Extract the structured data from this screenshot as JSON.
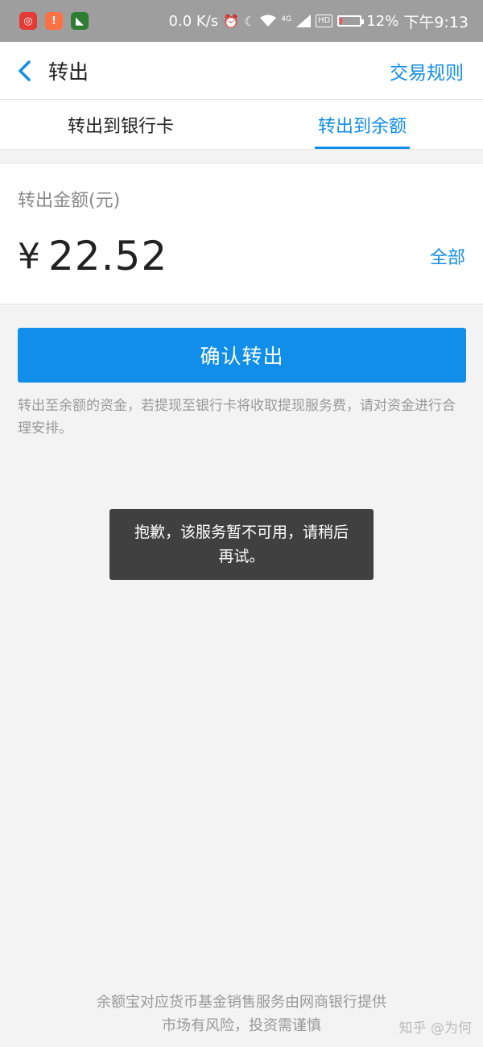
{
  "status_bar": {
    "net_speed": "0.0 K/s",
    "network": "4G",
    "hd": "HD",
    "battery_pct": "12%",
    "battery_level": 0.12,
    "time": "下午9:13",
    "colors": {
      "app1": "#e53935",
      "app2": "#ff7043",
      "app3": "#2e7d32"
    }
  },
  "header": {
    "back_icon": "chevron-left-icon",
    "title": "转出",
    "rules_link": "交易规则"
  },
  "tabs": [
    {
      "label": "转出到银行卡",
      "active": false
    },
    {
      "label": "转出到余额",
      "active": true
    }
  ],
  "amount": {
    "label": "转出金额(元)",
    "currency": "¥",
    "value": "22.52",
    "all_label": "全部"
  },
  "confirm_button": "确认转出",
  "notice": "转出至余额的资金，若提现至银行卡将收取提现服务费，请对资金进行合理安排。",
  "toast": "抱歉，该服务暂不可用，请稍后再试。",
  "footer": {
    "line1": "余额宝对应货币基金销售服务由网商银行提供",
    "line2": "市场有风险，投资需谨慎"
  },
  "watermark": "知乎 @为何",
  "accent_color": "#108ee9"
}
